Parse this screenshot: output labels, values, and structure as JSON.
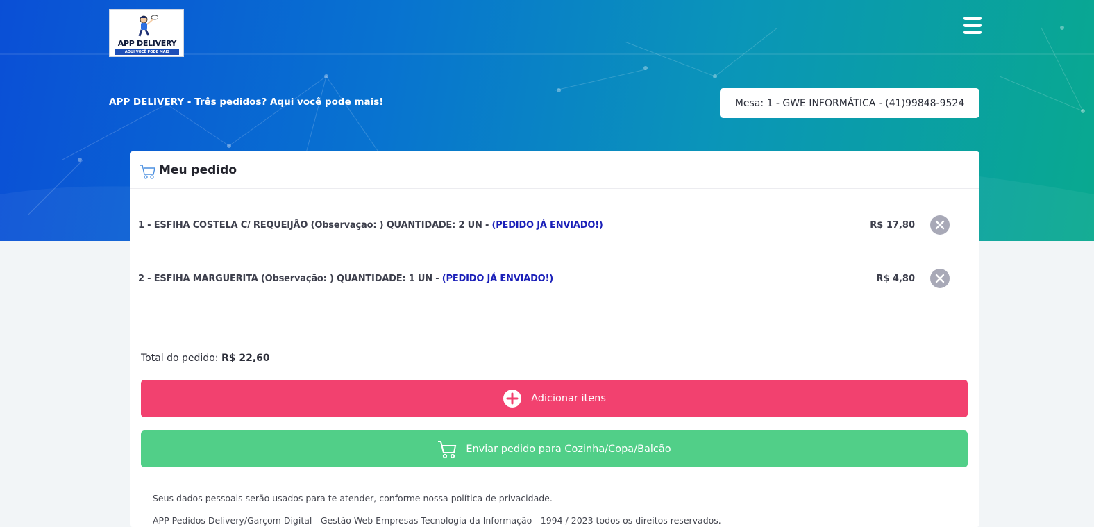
{
  "brand": {
    "logo_title": "APP DELIVERY",
    "logo_subtitle": "AQUI VOCÊ PODE MAIS",
    "tagline": "APP DELIVERY - Três pedidos? Aqui você pode mais!"
  },
  "table_info": "Mesa: 1 - GWE INFORMÁTICA - (41)99848-9524",
  "order": {
    "title": "Meu pedido",
    "items": [
      {
        "text": "1 - ESFIHA COSTELA C/ REQUEIJÃO (Observação: ) QUANTIDADE: 2 UN - ",
        "status": "(PEDIDO JÁ ENVIADO!)",
        "price": "R$ 17,80"
      },
      {
        "text": "2 - ESFIHA MARGUERITA (Observação: ) QUANTIDADE: 1 UN - ",
        "status": "(PEDIDO JÁ ENVIADO!)",
        "price": "R$ 4,80"
      }
    ],
    "total_label": "Total do pedido: ",
    "total_value": "R$ 22,60"
  },
  "actions": {
    "add_label": "Adicionar itens",
    "send_label": "Enviar pedido para Cozinha/Copa/Balcão"
  },
  "footer": {
    "privacy": "Seus dados pessoais serão usados para te atender, conforme nossa política de privacidade.",
    "copyright": "APP Pedidos Delivery/Garçom Digital - Gestão Web Empresas Tecnologia da Informação - 1994 / 2023 todos os direitos reservados."
  },
  "colors": {
    "add_button": "#f2416f",
    "send_button": "#51cf88",
    "status_text": "#1a1fb8"
  },
  "icons": [
    "menu-icon",
    "cart-icon",
    "close-icon",
    "plus-circle-icon",
    "cart-icon"
  ]
}
